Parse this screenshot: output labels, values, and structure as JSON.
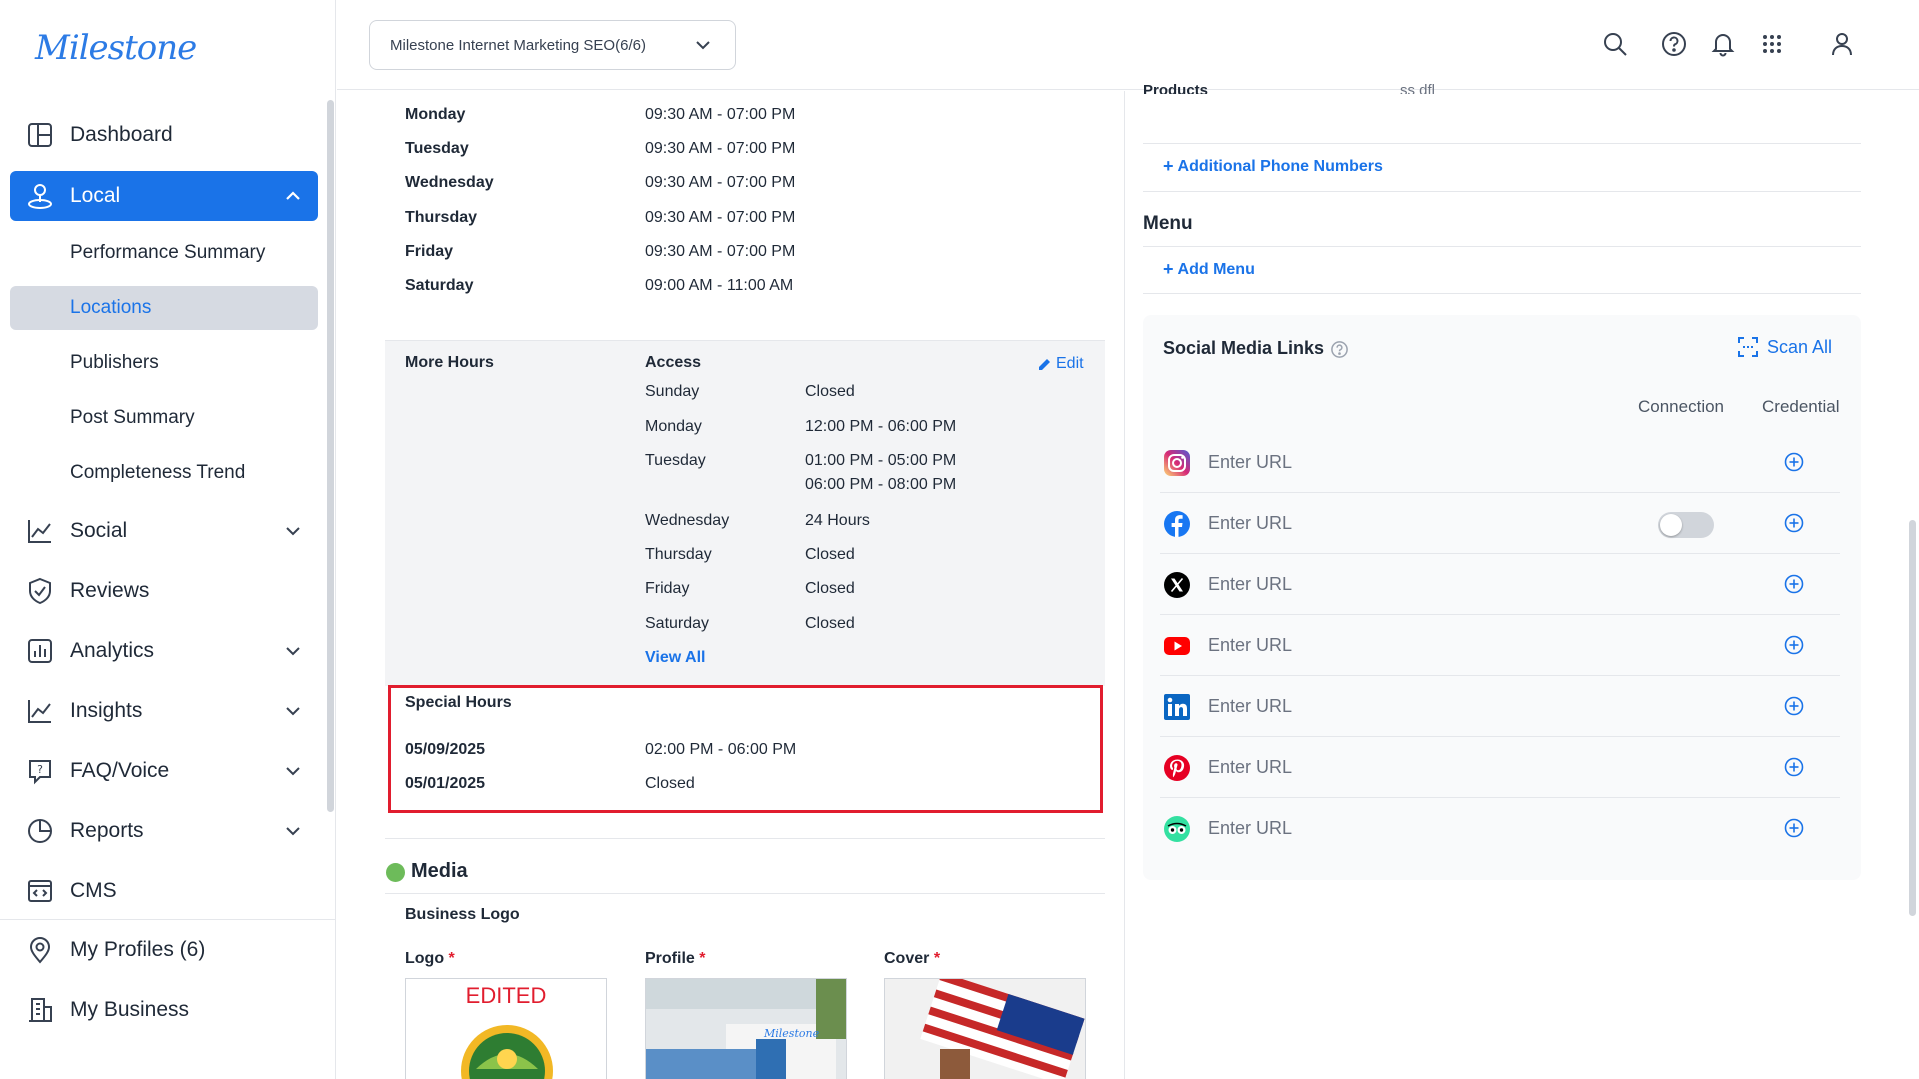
{
  "brand": {
    "logo_text": "Milestone",
    "accent": "#1a73e8",
    "highlight": "#e11d2e"
  },
  "org_selector": {
    "value": "Milestone Internet Marketing SEO(6/6)"
  },
  "sidebar": {
    "items": [
      {
        "label": "Dashboard",
        "icon": "dashboard-icon"
      },
      {
        "label": "Local",
        "icon": "local-pin-icon",
        "expanded": true
      },
      {
        "label": "Social",
        "icon": "social-chart-icon"
      },
      {
        "label": "Reviews",
        "icon": "reviews-check-icon"
      },
      {
        "label": "Analytics",
        "icon": "analytics-icon"
      },
      {
        "label": "Insights",
        "icon": "insights-icon"
      },
      {
        "label": "FAQ/Voice",
        "icon": "faq-icon"
      },
      {
        "label": "Reports",
        "icon": "reports-pie-icon"
      },
      {
        "label": "CMS",
        "icon": "cms-icon"
      },
      {
        "label": "My Profiles (6)",
        "icon": "location-pin-icon"
      },
      {
        "label": "My Business",
        "icon": "building-icon"
      }
    ],
    "local_sub": [
      {
        "label": "Performance Summary"
      },
      {
        "label": "Locations"
      },
      {
        "label": "Publishers"
      },
      {
        "label": "Post Summary"
      },
      {
        "label": "Completeness Trend"
      }
    ]
  },
  "hours": {
    "regular": [
      {
        "day": "Monday",
        "time": "09:30 AM - 07:00 PM"
      },
      {
        "day": "Tuesday",
        "time": "09:30 AM - 07:00 PM"
      },
      {
        "day": "Wednesday",
        "time": "09:30 AM - 07:00 PM"
      },
      {
        "day": "Thursday",
        "time": "09:30 AM - 07:00 PM"
      },
      {
        "day": "Friday",
        "time": "09:30 AM - 07:00 PM"
      },
      {
        "day": "Saturday",
        "time": "09:00 AM - 11:00 AM"
      }
    ],
    "more_hours": {
      "label": "More Hours",
      "type": "Access",
      "edit_label": "Edit",
      "view_all": "View All",
      "days": [
        {
          "day": "Sunday",
          "time": "Closed"
        },
        {
          "day": "Monday",
          "time": "12:00 PM - 06:00 PM"
        },
        {
          "day": "Tuesday",
          "time": "01:00 PM - 05:00 PM",
          "time2": "06:00 PM - 08:00 PM"
        },
        {
          "day": "Wednesday",
          "time": "24 Hours"
        },
        {
          "day": "Thursday",
          "time": "Closed"
        },
        {
          "day": "Friday",
          "time": "Closed"
        },
        {
          "day": "Saturday",
          "time": "Closed"
        }
      ]
    },
    "special": {
      "label": "Special Hours",
      "entries": [
        {
          "date": "05/09/2025",
          "time": "02:00 PM - 06:00 PM"
        },
        {
          "date": "05/01/2025",
          "time": "Closed"
        }
      ]
    }
  },
  "media": {
    "title": "Media",
    "business_logo": "Business Logo",
    "images": [
      {
        "label": "Logo",
        "req": "*",
        "caption": "EDITED"
      },
      {
        "label": "Profile",
        "req": "*"
      },
      {
        "label": "Cover",
        "req": "*"
      }
    ]
  },
  "right": {
    "cut_label": "Products",
    "cut_value": "ss dfl",
    "additional_phone": "Additional Phone Numbers",
    "menu_title": "Menu",
    "add_menu": "Add Menu",
    "social": {
      "title": "Social Media Links",
      "scan_all": "Scan All",
      "col_connection": "Connection",
      "col_credential": "Credential",
      "rows": [
        {
          "platform": "instagram-icon",
          "placeholder": "Enter URL",
          "color": "#e1306c"
        },
        {
          "platform": "facebook-icon",
          "placeholder": "Enter URL",
          "color": "#1877f2",
          "toggle": "off"
        },
        {
          "platform": "x-twitter-icon",
          "placeholder": "Enter URL",
          "color": "#000000"
        },
        {
          "platform": "youtube-icon",
          "placeholder": "Enter URL",
          "color": "#ff0000"
        },
        {
          "platform": "linkedin-icon",
          "placeholder": "Enter URL",
          "color": "#0a66c2"
        },
        {
          "platform": "pinterest-icon",
          "placeholder": "Enter URL",
          "color": "#e60023"
        },
        {
          "platform": "tripadvisor-icon",
          "placeholder": "Enter URL",
          "color": "#34e0a1"
        }
      ]
    }
  }
}
